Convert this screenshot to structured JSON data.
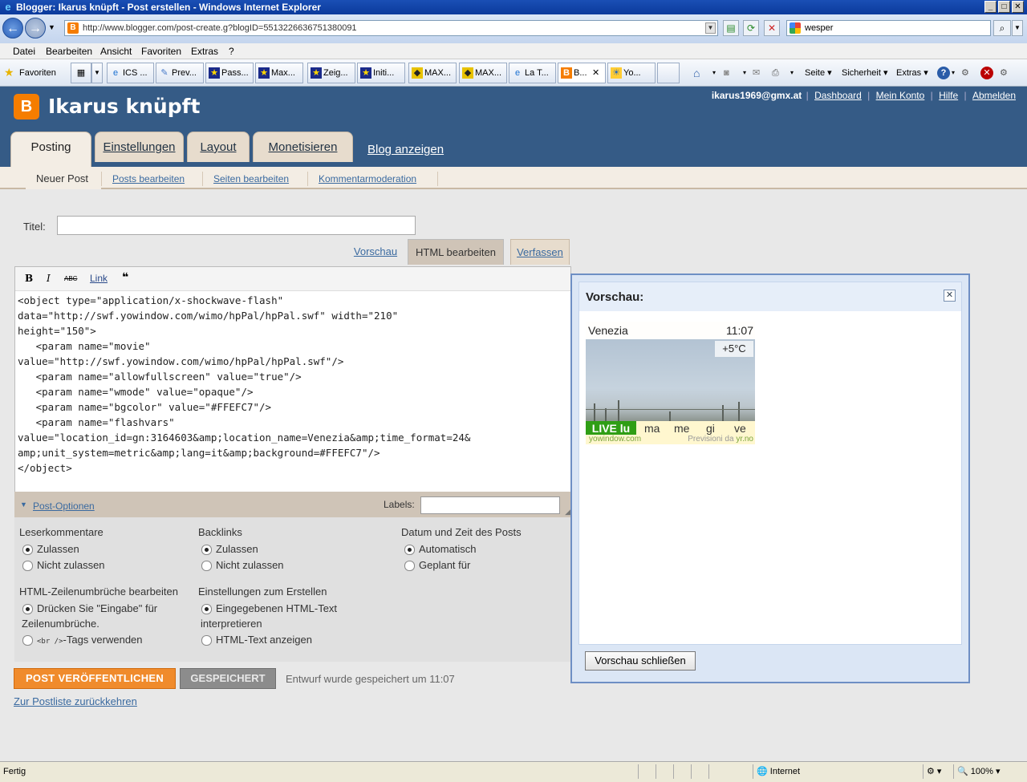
{
  "window": {
    "title": "Blogger: Ikarus knüpft - Post erstellen - Windows Internet Explorer"
  },
  "address": {
    "url": "http://www.blogger.com/post-create.g?blogID=5513226636751380091",
    "search_value": "wesper"
  },
  "menu": [
    "Datei",
    "Bearbeiten",
    "Ansicht",
    "Favoriten",
    "Extras",
    "?"
  ],
  "favbar": {
    "favorites_label": "Favoriten",
    "tabs": [
      "ICS ...",
      "Prev...",
      "Pass...",
      "Max...",
      "Zeig...",
      "Initi...",
      "MAX...",
      "MAX...",
      "La T...",
      "B...",
      "Yo..."
    ],
    "tools": [
      "Seite",
      "Sicherheit",
      "Extras"
    ]
  },
  "blog": {
    "title": "Ikarus knüpft",
    "user": "ikarus1969@gmx.at",
    "links": [
      "Dashboard",
      "Mein Konto",
      "Hilfe",
      "Abmelden"
    ],
    "tabs": [
      "Posting",
      "Einstellungen",
      "Layout",
      "Monetisieren"
    ],
    "view_blog": "Blog anzeigen",
    "subnav": [
      "Neuer Post",
      "Posts bearbeiten",
      "Seiten bearbeiten",
      "Kommentarmoderation"
    ]
  },
  "editor": {
    "title_label": "Titel:",
    "title_value": "",
    "modes": [
      "Vorschau",
      "HTML bearbeiten",
      "Verfassen"
    ],
    "toolbar": {
      "bold": "B",
      "italic": "I",
      "spell": "ABC",
      "link": "Link",
      "quote": "❝"
    },
    "code": "<object type=\"application/x-shockwave-flash\"\ndata=\"http://swf.yowindow.com/wimo/hpPal/hpPal.swf\" width=\"210\"\nheight=\"150\">\n   <param name=\"movie\"\nvalue=\"http://swf.yowindow.com/wimo/hpPal/hpPal.swf\"/>\n   <param name=\"allowfullscreen\" value=\"true\"/>\n   <param name=\"wmode\" value=\"opaque\"/>\n   <param name=\"bgcolor\" value=\"#FFEFC7\"/>\n   <param name=\"flashvars\"\nvalue=\"location_id=gn:3164603&amp;location_name=Venezia&amp;time_format=24&\namp;unit_system=metric&amp;lang=it&amp;background=#FFEFC7\"/>\n</object>"
  },
  "options": {
    "toggle": "Post-Optionen",
    "labels_label": "Labels:",
    "labels_value": "",
    "comments": {
      "heading": "Leserkommentare",
      "opt1": "Zulassen",
      "opt2": "Nicht zulassen"
    },
    "backlinks": {
      "heading": "Backlinks",
      "opt1": "Zulassen",
      "opt2": "Nicht zulassen"
    },
    "datetime": {
      "heading": "Datum und Zeit des Posts",
      "opt1": "Automatisch",
      "opt2": "Geplant für"
    },
    "linebreaks": {
      "heading": "HTML-Zeilenumbrüche bearbeiten",
      "opt1_line1": "Drücken Sie \"Eingabe\" für",
      "opt1_line2": "Zeilenumbrüche.",
      "opt2_tag": "<br />",
      "opt2_rest": "-Tags verwenden"
    },
    "compose": {
      "heading": "Einstellungen zum Erstellen",
      "opt1_line1": "Eingegebenen HTML-Text",
      "opt1_line2": "interpretieren",
      "opt2": "HTML-Text anzeigen"
    }
  },
  "actions": {
    "publish": "POST VERÖFFENTLICHEN",
    "saved": "GESPEICHERT",
    "draft_msg": "Entwurf wurde gespeichert um 11:07",
    "back": "Zur Postliste zurückkehren"
  },
  "preview": {
    "title": "Vorschau:",
    "close_label": "Vorschau schließen",
    "widget": {
      "city": "Venezia",
      "time": "11:07",
      "temp": "+5°C",
      "live": "LIVE lu",
      "days": [
        "ma",
        "me",
        "gi",
        "ve"
      ],
      "footer_left": "yowindow.com",
      "footer_right_prefix": "Previsioni da",
      "footer_right_link": "yr.no"
    }
  },
  "status": {
    "left": "Fertig",
    "zone": "Internet",
    "zoom": "100%"
  }
}
